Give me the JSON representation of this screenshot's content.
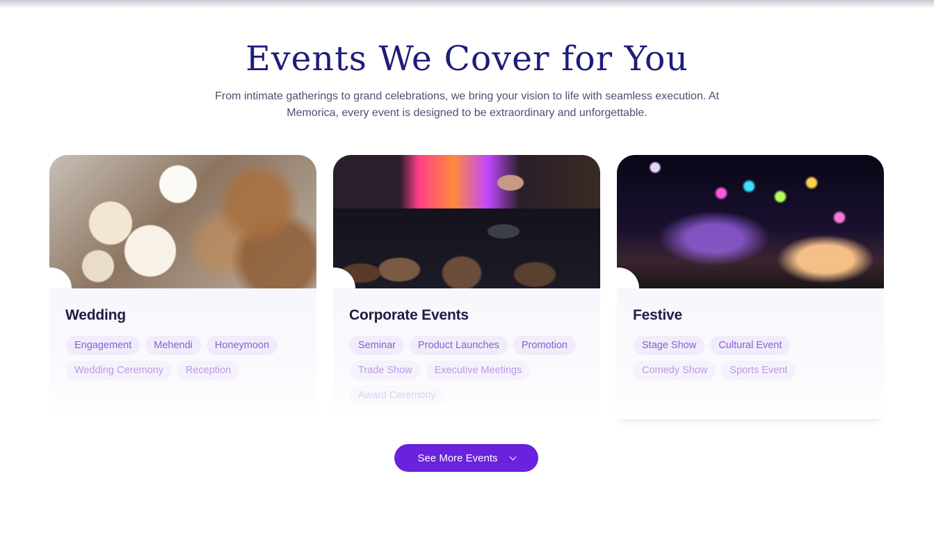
{
  "section": {
    "title": "Events We Cover for You",
    "subtitle": "From intimate gatherings to grand celebrations, we bring your vision to life with seamless execution. At Memorica, every event is designed to be extraordinary and unforgettable."
  },
  "cards": [
    {
      "title": "Wedding",
      "image": "wedding-flowers-photo",
      "tags": [
        "Engagement",
        "Mehendi",
        "Honeymoon",
        "Wedding Ceremony",
        "Reception"
      ]
    },
    {
      "title": "Corporate Events",
      "image": "corporate-speaker-photo",
      "tags": [
        "Seminar",
        "Product Launches",
        "Promotion",
        "Trade Show",
        "Executive Meetings",
        "Award Ceremony"
      ]
    },
    {
      "title": "Festive",
      "image": "festive-street-lights-photo",
      "tags": [
        "Stage Show",
        "Cultural Event",
        "Comedy Show",
        "Sports Event"
      ]
    }
  ],
  "see_more": {
    "label": "See More Events",
    "icon": "chevron-down-icon"
  },
  "colors": {
    "title": "#1d1d7a",
    "accent": "#6a22dd",
    "tag_text": "#8a5fd0",
    "tag_bg": "#f1ecfa"
  }
}
